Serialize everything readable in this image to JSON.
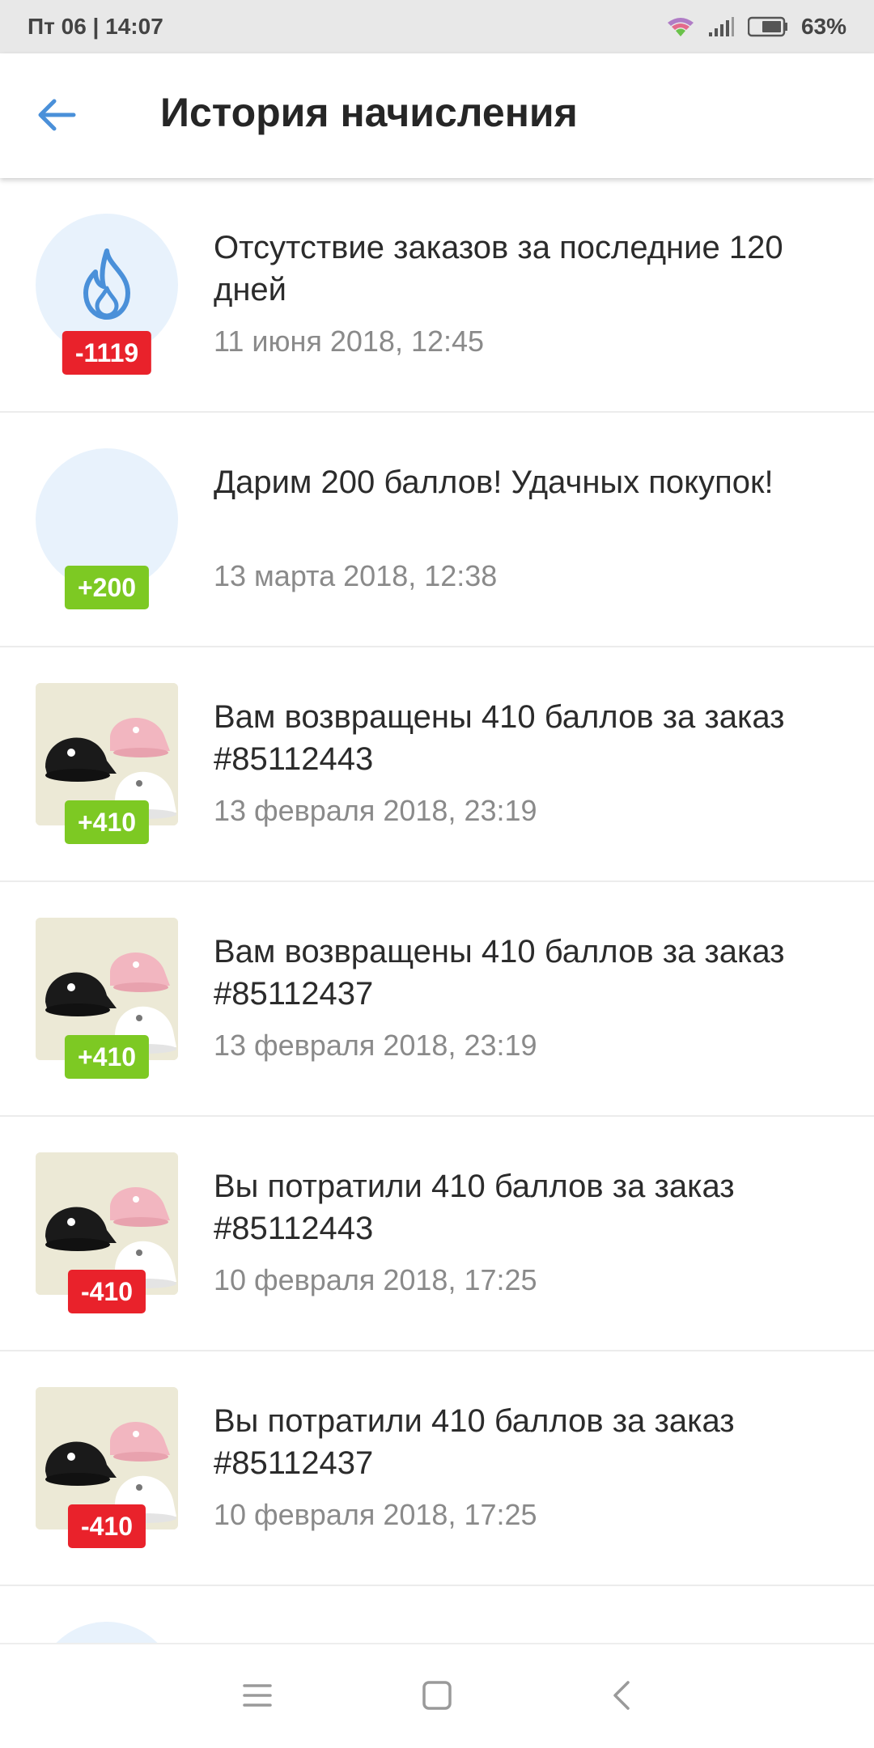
{
  "status_bar": {
    "time": "Пт 06 | 14:07",
    "battery": "63%",
    "icons": [
      "wifi-icon",
      "signal-icon",
      "battery-icon"
    ]
  },
  "header": {
    "title": "История начисления",
    "back_icon": "arrow-left-icon"
  },
  "colors": {
    "accent": "#4a90d9",
    "negative_badge": "#e9222b",
    "positive_badge": "#7dc923",
    "thumb_circle_bg": "#e8f2fc"
  },
  "items": [
    {
      "title": "Отсутствие заказов за последние 120 дней",
      "date": "11 июня 2018, 12:45",
      "points": "-1119",
      "thumbnail": "flame-icon"
    },
    {
      "title": "Дарим 200 баллов! Удачных покупок!",
      "date": "13 марта 2018, 12:38",
      "points": "+200",
      "thumbnail": "empty-circle"
    },
    {
      "title": "Вам возвращены 410 баллов за заказ #85112443",
      "date": "13 февраля 2018, 23:19",
      "points": "+410",
      "thumbnail": "caps-photo"
    },
    {
      "title": "Вам возвращены 410 баллов за заказ #85112437",
      "date": "13 февраля 2018, 23:19",
      "points": "+410",
      "thumbnail": "caps-photo"
    },
    {
      "title": "Вы потратили 410 баллов за заказ #85112443",
      "date": "10 февраля 2018, 17:25",
      "points": "-410",
      "thumbnail": "caps-photo"
    },
    {
      "title": "Вы потратили 410 баллов за заказ #85112437",
      "date": "10 февраля 2018, 17:25",
      "points": "-410",
      "thumbnail": "caps-photo"
    }
  ],
  "nav_bar": {
    "icons": [
      "menu-icon",
      "home-icon",
      "back-icon"
    ]
  }
}
